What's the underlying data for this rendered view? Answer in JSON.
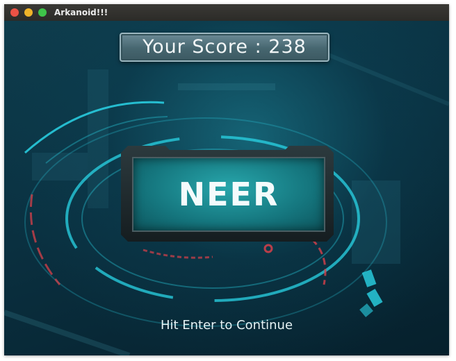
{
  "window": {
    "title": "Arkanoid!!!"
  },
  "score": {
    "text": "Your Score : 238"
  },
  "panel": {
    "text": "NEER"
  },
  "hint": {
    "text": "Hit Enter to Continue"
  },
  "colors": {
    "background_dark": "#0b2a36",
    "accent_cyan": "#2ad4e6",
    "accent_red": "#d8404a",
    "panel_teal": "#15767e"
  },
  "icons": [
    "close-button-icon",
    "minimize-button-icon",
    "maximize-button-icon"
  ]
}
